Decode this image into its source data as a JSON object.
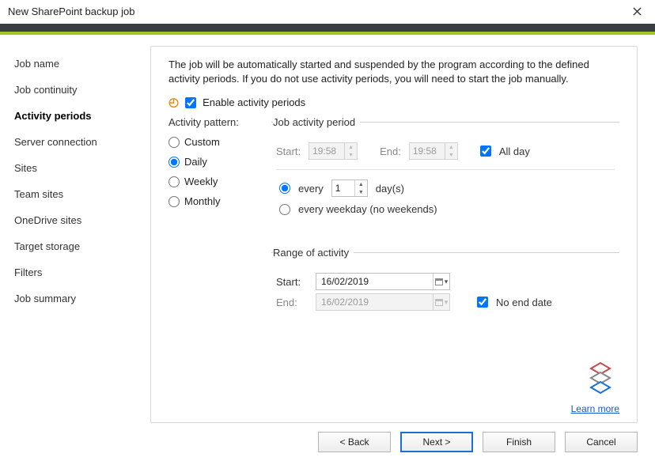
{
  "window": {
    "title": "New SharePoint backup job"
  },
  "sidebar": {
    "items": [
      {
        "label": "Job name"
      },
      {
        "label": "Job continuity"
      },
      {
        "label": "Activity periods",
        "active": true
      },
      {
        "label": "Server connection"
      },
      {
        "label": "Sites"
      },
      {
        "label": "Team sites"
      },
      {
        "label": "OneDrive sites"
      },
      {
        "label": "Target storage"
      },
      {
        "label": "Filters"
      },
      {
        "label": "Job summary"
      }
    ]
  },
  "description": "The job will be automatically started and suspended by the program according to the defined activity periods. If you do not use activity periods, you will need to start the job manually.",
  "enable": {
    "label": "Enable activity periods",
    "checked": true
  },
  "activity_pattern": {
    "label": "Activity pattern:",
    "options": [
      "Custom",
      "Daily",
      "Weekly",
      "Monthly"
    ],
    "selected": "Daily"
  },
  "job_activity_period": {
    "legend": "Job activity period",
    "start_label": "Start:",
    "end_label": "End:",
    "start_time": "19:58",
    "end_time": "19:58",
    "all_day_label": "All day",
    "all_day_checked": true,
    "every_label_prefix": "every",
    "every_value": "1",
    "every_label_suffix": "day(s)",
    "every_selected": true,
    "every_weekday_label": "every weekday (no weekends)",
    "every_weekday_selected": false
  },
  "range_of_activity": {
    "legend": "Range of activity",
    "start_label": "Start:",
    "end_label": "End:",
    "start_date": "16/02/2019",
    "end_date": "16/02/2019",
    "no_end_date_label": "No end date",
    "no_end_date_checked": true
  },
  "learn_more": "Learn more",
  "buttons": {
    "back": "< Back",
    "next": "Next >",
    "finish": "Finish",
    "cancel": "Cancel"
  }
}
